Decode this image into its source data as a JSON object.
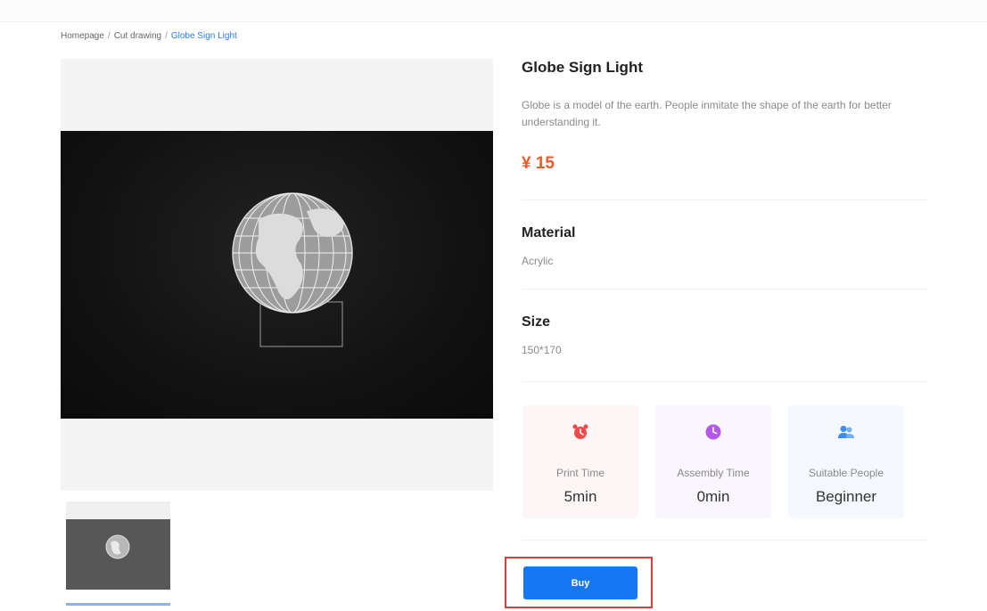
{
  "breadcrumb": {
    "items": [
      "Homepage",
      "Cut drawing",
      "Globe Sign Light"
    ],
    "separator": "/"
  },
  "product": {
    "title": "Globe Sign Light",
    "description": "Globe is a model of the earth. People inmitate the shape of the earth for better understanding it.",
    "price": "¥ 15"
  },
  "material": {
    "title": "Material",
    "value": "Acrylic"
  },
  "size": {
    "title": "Size",
    "value": "150*170"
  },
  "stats": [
    {
      "icon": "alarm-clock-icon",
      "label": "Print Time",
      "value": "5min",
      "color": "#ef4b4b"
    },
    {
      "icon": "clock-icon",
      "label": "Assembly Time",
      "value": "0min",
      "color": "#b458e8"
    },
    {
      "icon": "people-icon",
      "label": "Suitable People",
      "value": "Beginner",
      "color": "#3b8df3"
    }
  ],
  "actions": {
    "buy_label": "Buy"
  },
  "colors": {
    "accent": "#1677f4",
    "price": "#f05a28",
    "highlight": "#e53935"
  }
}
